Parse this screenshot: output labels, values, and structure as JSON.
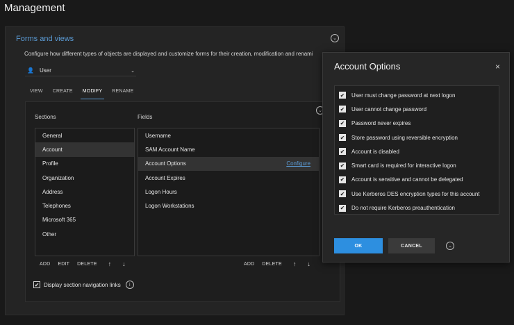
{
  "page": {
    "title": "Management"
  },
  "card": {
    "title": "Forms and views",
    "description": "Configure how different types of objects are displayed and customize forms for their creation, modification and renaming.",
    "collapse_icon": "chevron-down-circle-icon"
  },
  "type_select": {
    "value": "User",
    "icon": "user-icon",
    "chevron": "chevron-down-icon"
  },
  "tabs": [
    {
      "label": "VIEW",
      "active": false
    },
    {
      "label": "CREATE",
      "active": false
    },
    {
      "label": "MODIFY",
      "active": true
    },
    {
      "label": "RENAME",
      "active": false
    }
  ],
  "sections": {
    "heading": "Sections",
    "items": [
      "General",
      "Account",
      "Profile",
      "Organization",
      "Address",
      "Telephones",
      "Microsoft 365",
      "Other"
    ],
    "selected": "Account",
    "toolbar": {
      "add": "ADD",
      "edit": "EDIT",
      "delete": "DELETE",
      "up": "↑",
      "down": "↓"
    }
  },
  "fields": {
    "heading": "Fields",
    "items": [
      "Username",
      "SAM Account Name",
      "Account Options",
      "Account Expires",
      "Logon Hours",
      "Logon Workstations"
    ],
    "selected": "Account Options",
    "configure_link": "Configure",
    "toolbar": {
      "add": "ADD",
      "delete": "DELETE",
      "up": "↑",
      "down": "↓"
    }
  },
  "display_nav": {
    "label": "Display section navigation links",
    "checked": true
  },
  "dialog": {
    "title": "Account Options",
    "close": "×",
    "options": [
      {
        "label": "User must change password at next logon",
        "checked": true
      },
      {
        "label": "User cannot change password",
        "checked": true
      },
      {
        "label": "Password never expires",
        "checked": true
      },
      {
        "label": "Store password using reversible encryption",
        "checked": true
      },
      {
        "label": "Account is disabled",
        "checked": true
      },
      {
        "label": "Smart card is required for interactive logon",
        "checked": true
      },
      {
        "label": "Account is sensitive and cannot be delegated",
        "checked": true
      },
      {
        "label": "Use Kerberos DES encryption types for this account",
        "checked": true
      },
      {
        "label": "Do not require Kerberos preauthentication",
        "checked": true
      }
    ],
    "ok": "OK",
    "cancel": "CANCEL"
  },
  "colors": {
    "accent": "#2d8fe0",
    "link": "#5b9bd5",
    "background": "#191919"
  }
}
